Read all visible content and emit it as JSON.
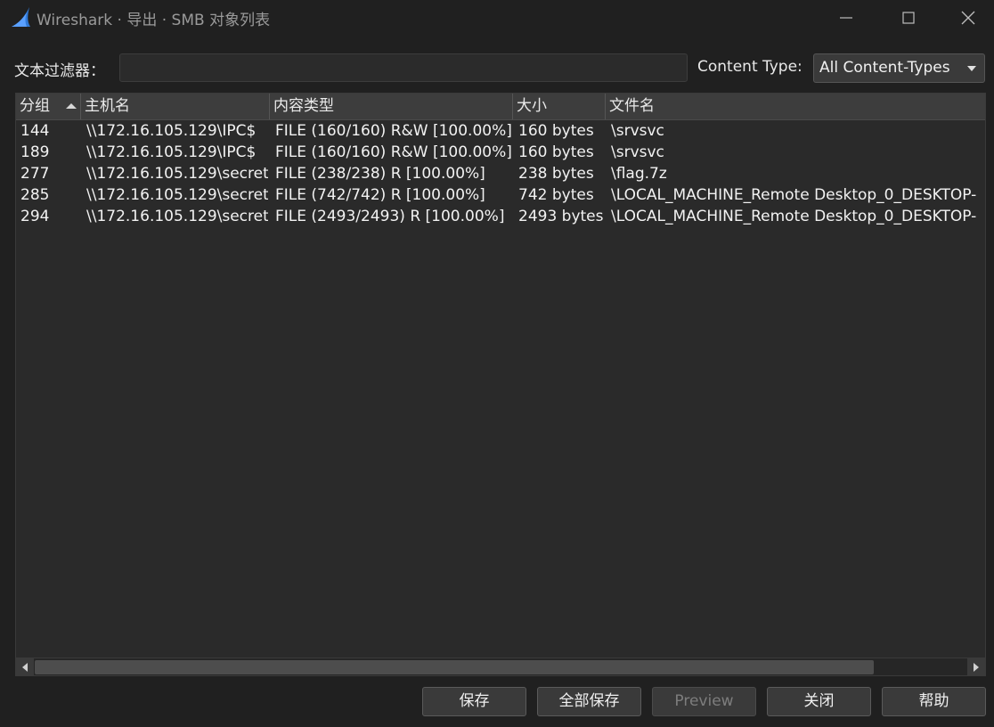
{
  "window": {
    "title": "Wireshark · 导出 · SMB 对象列表",
    "icon": "wireshark-fin-icon",
    "controls": [
      "minimize-icon",
      "maximize-icon",
      "close-icon"
    ]
  },
  "filter": {
    "label": "文本过滤器：",
    "value": "",
    "placeholder": ""
  },
  "content_type": {
    "label": "Content Type:",
    "selected": "All Content-Types"
  },
  "table": {
    "columns": [
      "分组",
      "主机名",
      "内容类型",
      "大小",
      "文件名"
    ],
    "sorted_column": "分组",
    "sort_direction": "ascending",
    "rows": [
      [
        "144",
        "\\\\172.16.105.129\\IPC$",
        "FILE (160/160) R&W [100.00%]",
        "160 bytes",
        "\\srvsvc"
      ],
      [
        "189",
        "\\\\172.16.105.129\\IPC$",
        "FILE (160/160) R&W [100.00%]",
        "160 bytes",
        "\\srvsvc"
      ],
      [
        "277",
        "\\\\172.16.105.129\\secret",
        "FILE (238/238) R [100.00%]",
        "238 bytes",
        "\\flag.7z"
      ],
      [
        "285",
        "\\\\172.16.105.129\\secret",
        "FILE (742/742) R [100.00%]",
        "742 bytes",
        "\\LOCAL_MACHINE_Remote Desktop_0_DESKTOP-"
      ],
      [
        "294",
        "\\\\172.16.105.129\\secret",
        "FILE (2493/2493) R [100.00%]",
        "2493 bytes",
        "\\LOCAL_MACHINE_Remote Desktop_0_DESKTOP-"
      ]
    ]
  },
  "buttons": {
    "save": "保存",
    "save_all": "全部保存",
    "preview": "Preview",
    "close": "关闭",
    "help": "帮助"
  },
  "colors": {
    "background": "#202020",
    "header": "#3d3d3d",
    "table_bg": "#2a2a2a",
    "title_text": "#9a9a9a",
    "icon_blue": "#2f78d6"
  }
}
